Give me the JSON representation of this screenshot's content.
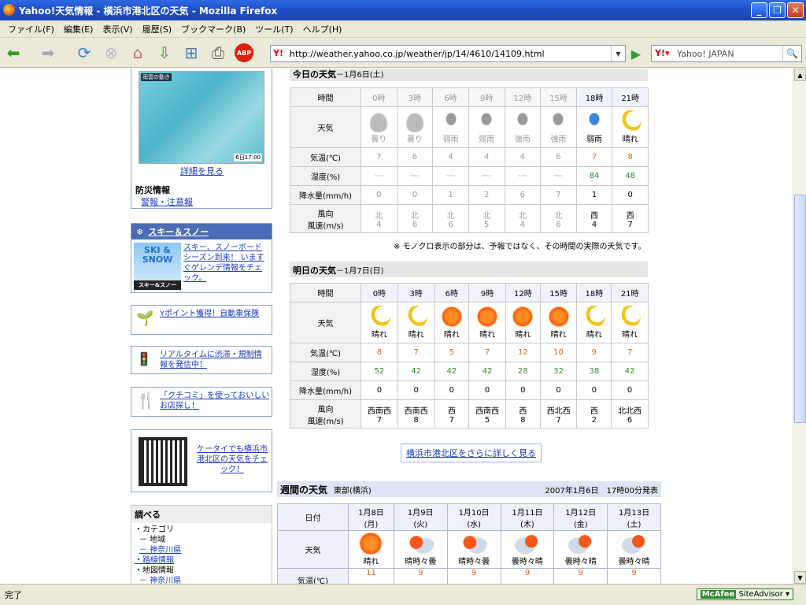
{
  "window": {
    "title": "Yahoo!天気情報 - 横浜市港北区の天気 - Mozilla Firefox"
  },
  "menu": [
    "ファイル(F)",
    "編集(E)",
    "表示(V)",
    "履歴(S)",
    "ブックマーク(B)",
    "ツール(T)",
    "ヘルプ(H)"
  ],
  "url": "http://weather.yahoo.co.jp/weather/jp/14/4610/14109.html",
  "search_placeholder": "Yahoo! JAPAN",
  "status": "完了",
  "mcafee": {
    "brand": "McAfee",
    "product": "SiteAdvisor"
  },
  "sidebar": {
    "map_label": "雨雲の動き",
    "map_time": "6日17:00",
    "map_link": "詳細を見る",
    "bousai_title": "防災情報",
    "bousai_link": "警報・注意報",
    "ski_title": "スキー＆スノー",
    "ski_text": "スキー、スノーボードシーズン到来！ いますぐゲレンデ情報をチェック。",
    "ski_img": "SKI & SNOW",
    "ski_img_sub": "スキー&スノー",
    "points": "Yポイント獲得！自動車保険",
    "traffic": "リアルタイムに渋滞・規制情報を発信中！",
    "kuchikomi": "「クチコミ」を使っておいしいお店探し！",
    "mobile": "ケータイでも横浜市港北区の天気をチェック！",
    "search_title": "調べる",
    "search_items": [
      "・カテゴリ",
      "－ 地域",
      "－ 神奈川県",
      "・路線情報",
      "・地図情報",
      "－ 神奈川県"
    ]
  },
  "today": {
    "title": "今日の天気",
    "date": "－1月6日(土)",
    "row_labels": [
      "時間",
      "天気",
      "気温(℃)",
      "湿度(%)",
      "降水量(mm/h)",
      "風向",
      "風速(m/s)"
    ],
    "times": [
      "0時",
      "3時",
      "6時",
      "9時",
      "12時",
      "15時",
      "18時",
      "21時"
    ],
    "icons": [
      "cloud",
      "cloud",
      "rain",
      "rain",
      "rain",
      "rain",
      "rain18",
      "moon"
    ],
    "weather": [
      "曇り",
      "曇り",
      "弱雨",
      "弱雨",
      "強雨",
      "強雨",
      "弱雨",
      "晴れ"
    ],
    "temp": [
      "7",
      "6",
      "4",
      "4",
      "4",
      "6",
      "7",
      "8"
    ],
    "humidity": [
      "---",
      "---",
      "---",
      "---",
      "---",
      "---",
      "84",
      "48"
    ],
    "precip": [
      "0",
      "0",
      "1",
      "2",
      "6",
      "7",
      "1",
      "0"
    ],
    "wind_dir": [
      "北",
      "北",
      "北",
      "北",
      "北",
      "北",
      "西",
      "西"
    ],
    "wind_speed": [
      "4",
      "6",
      "6",
      "5",
      "4",
      "6",
      "4",
      "7"
    ],
    "note": "※ モノクロ表示の部分は、予報ではなく、その時間の実際の天気です。"
  },
  "tomorrow": {
    "title": "明日の天気",
    "date": "－1月7日(日)",
    "times": [
      "0時",
      "3時",
      "6時",
      "9時",
      "12時",
      "15時",
      "18時",
      "21時"
    ],
    "icons": [
      "moon",
      "moon",
      "sun",
      "sun",
      "sun",
      "sun",
      "moon",
      "moon"
    ],
    "weather": [
      "晴れ",
      "晴れ",
      "晴れ",
      "晴れ",
      "晴れ",
      "晴れ",
      "晴れ",
      "晴れ"
    ],
    "temp": [
      "8",
      "7",
      "5",
      "7",
      "12",
      "10",
      "9",
      "7"
    ],
    "humidity": [
      "52",
      "42",
      "42",
      "42",
      "28",
      "32",
      "38",
      "42"
    ],
    "precip": [
      "0",
      "0",
      "0",
      "0",
      "0",
      "0",
      "0",
      "0"
    ],
    "wind_dir": [
      "西南西",
      "西南西",
      "西",
      "西南西",
      "西",
      "西北西",
      "西",
      "北北西"
    ],
    "wind_speed": [
      "7",
      "8",
      "7",
      "5",
      "8",
      "7",
      "2",
      "6"
    ],
    "more_link": "横浜市港北区をさらに詳しく見る"
  },
  "weekly": {
    "title": "週間の天気",
    "region": "東部(横浜)",
    "issued": "2007年1月6日　17時00分発表",
    "row_labels": [
      "日付",
      "天気",
      "気温(℃)"
    ],
    "dates": [
      "1月8日",
      "1月9日",
      "1月10日",
      "1月11日",
      "1月12日",
      "1月13日"
    ],
    "days": [
      "(月)",
      "(火)",
      "(水)",
      "(木)",
      "(金)",
      "(土)"
    ],
    "icons": [
      "sun",
      "suncloud",
      "suncloud",
      "cloudsun",
      "cloudsun",
      "cloudsun"
    ],
    "weather": [
      "晴れ",
      "晴時々曇",
      "晴時々曇",
      "曇時々晴",
      "曇時々晴",
      "曇時々晴"
    ],
    "high": [
      "11",
      "9",
      "9",
      "9",
      "9",
      "9"
    ]
  }
}
